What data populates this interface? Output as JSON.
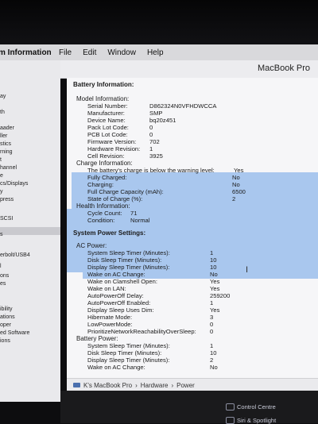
{
  "menubar": {
    "app_name": "m Information",
    "items": [
      "File",
      "Edit",
      "Window",
      "Help"
    ]
  },
  "window": {
    "title": "MacBook Pro"
  },
  "sidebar": {
    "items": [
      "ay",
      "th",
      "aader",
      "ller",
      "stics",
      "rning",
      "t",
      "hannel",
      "e",
      "cs/Displays",
      "y",
      "press",
      "SCSI",
      "s",
      "",
      "erbolt/USB4",
      "l",
      "ons",
      "es",
      "ibility",
      "ations",
      "oper",
      "ed Software",
      "ions"
    ]
  },
  "battery": {
    "section_title": "Battery Information:",
    "model_info_label": "Model Information:",
    "model": [
      {
        "k": "Serial Number:",
        "v": "D862324N0VFHDWCCA"
      },
      {
        "k": "Manufacturer:",
        "v": "SMP"
      },
      {
        "k": "Device Name:",
        "v": "bq20z451"
      },
      {
        "k": "Pack Lot Code:",
        "v": "0"
      },
      {
        "k": "PCB Lot Code:",
        "v": "0"
      },
      {
        "k": "Firmware Version:",
        "v": "702"
      },
      {
        "k": "Hardware Revision:",
        "v": "1"
      },
      {
        "k": "Cell Revision:",
        "v": "3925"
      }
    ],
    "charge_info_label": "Charge Information:",
    "charge": [
      {
        "k": "The battery's charge is below the warning level:",
        "v": "Yes"
      },
      {
        "k": "Fully Charged:",
        "v": "No"
      },
      {
        "k": "Charging:",
        "v": "No"
      },
      {
        "k": "Full Charge Capacity (mAh):",
        "v": "6500"
      },
      {
        "k": "State of Charge (%):",
        "v": "2"
      }
    ],
    "health_info_label": "Health Information:",
    "health": [
      {
        "k": "Cycle Count:",
        "v": "71"
      },
      {
        "k": "Condition:",
        "v": "Normal"
      }
    ]
  },
  "power": {
    "section_title": "System Power Settings:",
    "ac_label": "AC Power:",
    "ac": [
      {
        "k": "System Sleep Timer (Minutes):",
        "v": "1"
      },
      {
        "k": "Disk Sleep Timer (Minutes):",
        "v": "10"
      },
      {
        "k": "Display Sleep Timer (Minutes):",
        "v": "10"
      },
      {
        "k": "Wake on AC Change:",
        "v": "No"
      },
      {
        "k": "Wake on Clamshell Open:",
        "v": "Yes"
      },
      {
        "k": "Wake on LAN:",
        "v": "Yes"
      },
      {
        "k": "AutoPowerOff Delay:",
        "v": "259200"
      },
      {
        "k": "AutoPowerOff Enabled:",
        "v": "1"
      },
      {
        "k": "Display Sleep Uses Dim:",
        "v": "Yes"
      },
      {
        "k": "Hibernate Mode:",
        "v": "3"
      },
      {
        "k": "LowPowerMode:",
        "v": "0"
      },
      {
        "k": "PrioritizeNetworkReachabilityOverSleep:",
        "v": "0"
      }
    ],
    "battery_label": "Battery Power:",
    "battery": [
      {
        "k": "System Sleep Timer (Minutes):",
        "v": "1"
      },
      {
        "k": "Disk Sleep Timer (Minutes):",
        "v": "10"
      },
      {
        "k": "Display Sleep Timer (Minutes):",
        "v": "2"
      },
      {
        "k": "Wake on AC Change:",
        "v": "No"
      }
    ]
  },
  "pathbar": {
    "items": [
      "K's MacBook Pro",
      "›",
      "Hardware",
      "›",
      "Power"
    ]
  },
  "control_center": {
    "items": [
      "Control Centre",
      "Siri & Spotlight"
    ]
  },
  "colors": {
    "selection": "#a9c7ee",
    "menubar": "#d9d9dc"
  }
}
